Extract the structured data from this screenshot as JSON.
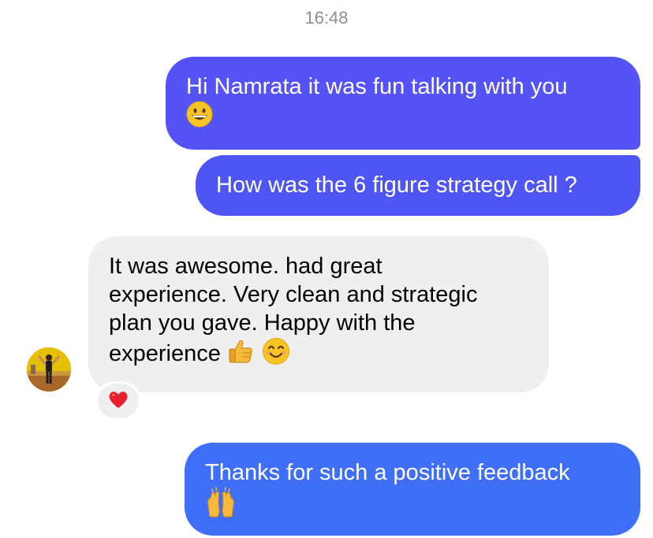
{
  "thread": {
    "timestamp": "16:48",
    "messages": [
      {
        "direction": "outgoing",
        "text": "Hi Namrata it was fun talking with you",
        "emoji": "grinning-face"
      },
      {
        "direction": "outgoing",
        "text": "How was the 6 figure strategy call ?"
      },
      {
        "direction": "incoming",
        "lines": [
          "It was awesome. had great",
          "experience. Very clean and strategic",
          "plan you gave. Happy with the",
          "experience"
        ],
        "emojis": [
          "thumbs-up",
          "smiling-face-with-smiling-eyes"
        ],
        "reaction": "red-heart"
      },
      {
        "direction": "outgoing",
        "text": "Thanks for such a positive feedback",
        "emoji": "raising-hands"
      }
    ]
  },
  "colors": {
    "outgoing_bubble_1": "#5552f6",
    "outgoing_bubble_2": "#4f55f5",
    "outgoing_bubble_3": "#3f6ff8",
    "incoming_bubble": "#efefef",
    "timestamp": "#8e8e93"
  }
}
